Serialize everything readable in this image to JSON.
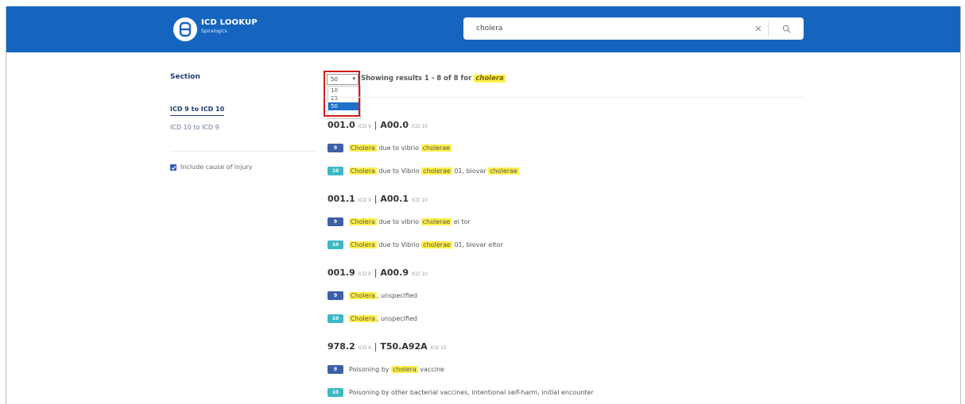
{
  "header": {
    "app_title": "ICD LOOKUP",
    "app_subtitle": "Spiralogics",
    "search_value": "cholera",
    "clear_symbol": "✕"
  },
  "sidebar": {
    "heading": "Section",
    "items": [
      {
        "label": "ICD 9 to ICD 10",
        "active": true
      },
      {
        "label": "ICD 10 to ICD 9",
        "active": false
      }
    ],
    "checkbox": {
      "label": "Include cause of injury",
      "checked": true
    }
  },
  "results_header": {
    "page_size": "50",
    "page_size_options": [
      "10",
      "25",
      "50"
    ],
    "showing_prefix": "Showing results 1 - 8 of 8 for",
    "query": "cholera"
  },
  "groups": [
    {
      "icd9": "001.0",
      "icd9_tag": "ICD 9",
      "separator": "|",
      "icd10": "A00.0",
      "icd10_tag": "ICD 10",
      "rows": [
        {
          "badge": "9",
          "parts": [
            {
              "t": "Cholera",
              "h": true
            },
            {
              "t": " due to vibrio ",
              "h": false
            },
            {
              "t": "cholerae",
              "h": true
            }
          ]
        },
        {
          "badge": "10",
          "parts": [
            {
              "t": "Cholera",
              "h": true
            },
            {
              "t": " due to Vibrio ",
              "h": false
            },
            {
              "t": "cholerae",
              "h": true
            },
            {
              "t": " 01, biovar ",
              "h": false
            },
            {
              "t": "cholerae",
              "h": true
            }
          ]
        }
      ]
    },
    {
      "icd9": "001.1",
      "icd9_tag": "ICD 9",
      "separator": "|",
      "icd10": "A00.1",
      "icd10_tag": "ICD 10",
      "rows": [
        {
          "badge": "9",
          "parts": [
            {
              "t": "Cholera",
              "h": true
            },
            {
              "t": " due to vibrio ",
              "h": false
            },
            {
              "t": "cholerae",
              "h": true
            },
            {
              "t": " el tor",
              "h": false
            }
          ]
        },
        {
          "badge": "10",
          "parts": [
            {
              "t": "Cholera",
              "h": true
            },
            {
              "t": " due to Vibrio ",
              "h": false
            },
            {
              "t": "cholerae",
              "h": true
            },
            {
              "t": " 01, biovar eltor",
              "h": false
            }
          ]
        }
      ]
    },
    {
      "icd9": "001.9",
      "icd9_tag": "ICD 9",
      "separator": "|",
      "icd10": "A00.9",
      "icd10_tag": "ICD 10",
      "rows": [
        {
          "badge": "9",
          "parts": [
            {
              "t": "Cholera",
              "h": true
            },
            {
              "t": ", unspecified",
              "h": false
            }
          ]
        },
        {
          "badge": "10",
          "parts": [
            {
              "t": "Cholera",
              "h": true
            },
            {
              "t": ", unspecified",
              "h": false
            }
          ]
        }
      ]
    },
    {
      "icd9": "978.2",
      "icd9_tag": "ICD 9",
      "separator": "|",
      "icd10": "T50.A92A",
      "icd10_tag": "ICD 10",
      "rows": [
        {
          "badge": "9",
          "parts": [
            {
              "t": "Poisoning by ",
              "h": false
            },
            {
              "t": "cholera",
              "h": true
            },
            {
              "t": " vaccine",
              "h": false
            }
          ]
        },
        {
          "badge": "10",
          "parts": [
            {
              "t": "Poisoning by other bacterial vaccines, intentional self-harm, initial encounter",
              "h": false
            }
          ]
        }
      ]
    }
  ],
  "colors": {
    "header_bg": "#1565c0",
    "highlight": "#fff04a",
    "badge_icd9": "#3d5fa7",
    "badge_icd10": "#3bb8c3",
    "annotation_box": "#d11b1b"
  }
}
